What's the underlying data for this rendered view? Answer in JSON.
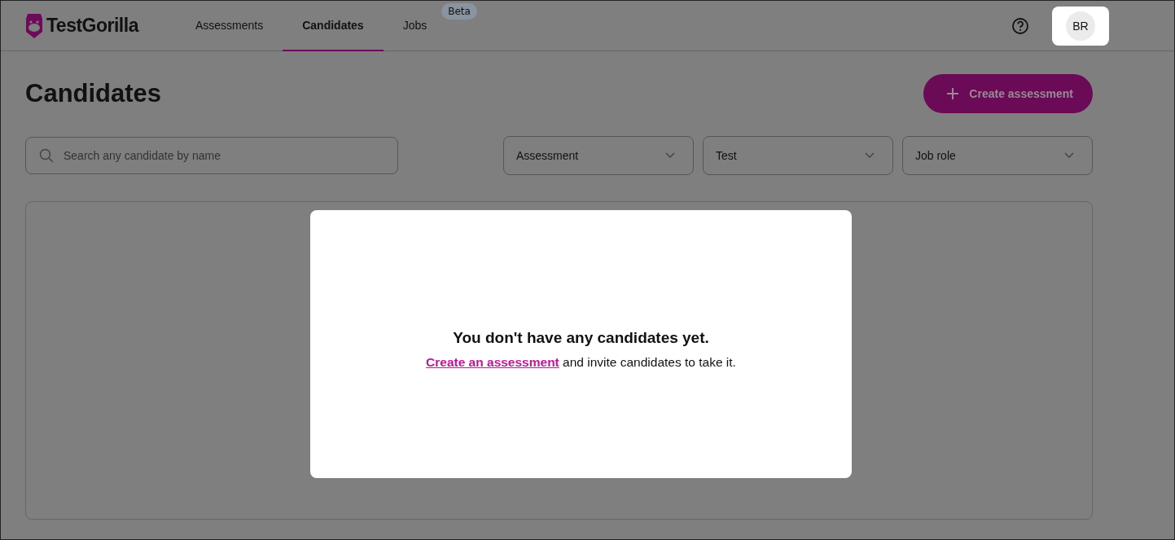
{
  "header": {
    "logo": "TestGorilla",
    "tabs": [
      {
        "label": "Assessments",
        "selected": false
      },
      {
        "label": "Candidates",
        "selected": true
      },
      {
        "label": "Jobs",
        "selected": false,
        "badge": "Beta"
      }
    ],
    "avatar": "BR"
  },
  "page": {
    "title": "Candidates",
    "create_button": "Create assessment",
    "search": {
      "placeholder": "Search any candidate by name"
    },
    "filters": [
      "Assessment",
      "Test",
      "Job role"
    ]
  },
  "empty_state": {
    "heading": "You don't have any candidates yet.",
    "link": "Create an assessment",
    "text": "and invite candidates to take it."
  }
}
